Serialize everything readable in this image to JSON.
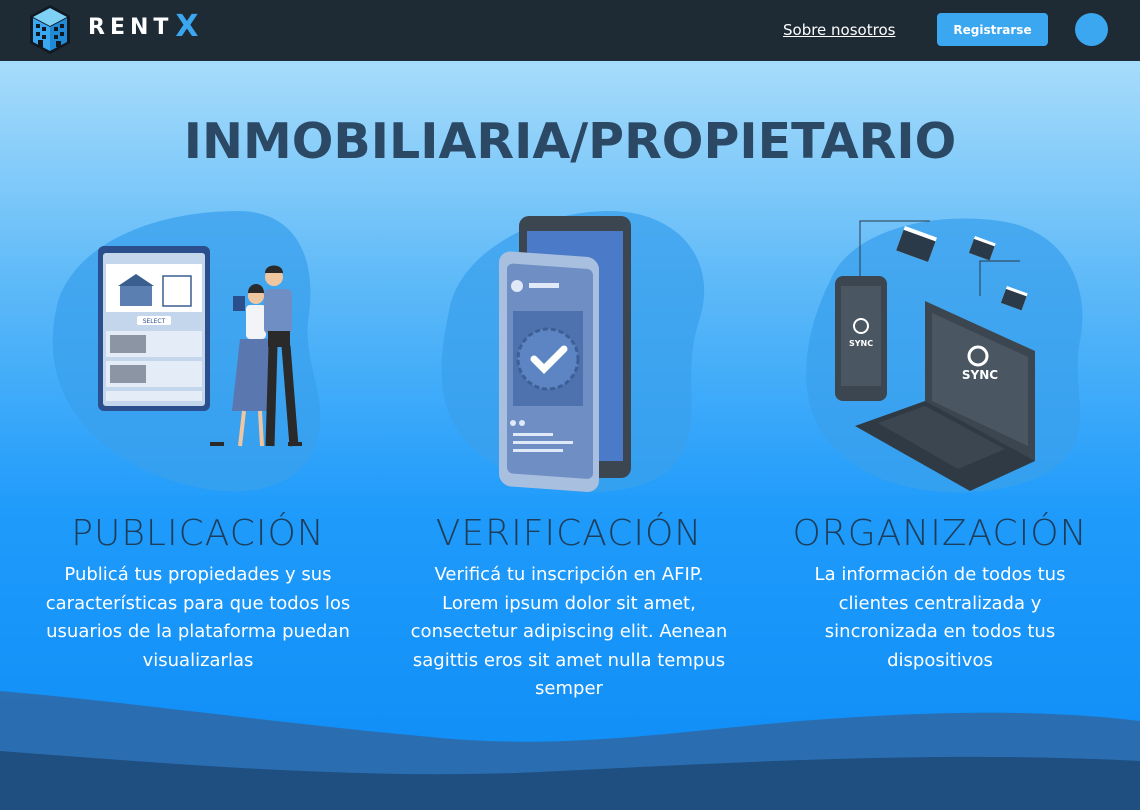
{
  "nav": {
    "brand_text": "RENT",
    "brand_accent": "X",
    "about_link": "Sobre nosotros",
    "register_label": "Registrarse"
  },
  "hero": {
    "title": "INMOBILIARIA/PROPIETARIO"
  },
  "features": [
    {
      "title": "PUBLICACIÓN",
      "description": "Publicá tus propiedades y sus características para que todos los usuarios de la plataforma puedan visualizarlas",
      "icon": "publication-illustration",
      "select_label": "SELECT"
    },
    {
      "title": "VERIFICACIÓN",
      "description": "Verificá tu inscripción en AFIP. Lorem ipsum dolor sit amet, consectetur adipiscing elit. Aenean sagittis eros sit amet nulla tempus semper",
      "icon": "verification-illustration"
    },
    {
      "title": "ORGANIZACIÓN",
      "description": "La información de todos tus clientes centralizada y sincronizada en todos tus dispositivos",
      "icon": "organization-illustration",
      "sync_label": "SYNC"
    }
  ],
  "colors": {
    "nav_bg": "#1e2a34",
    "accent": "#3aa7f0",
    "title": "#2b4864",
    "feature_title": "#1e3d5a",
    "wave_dark": "#1f4e80"
  }
}
